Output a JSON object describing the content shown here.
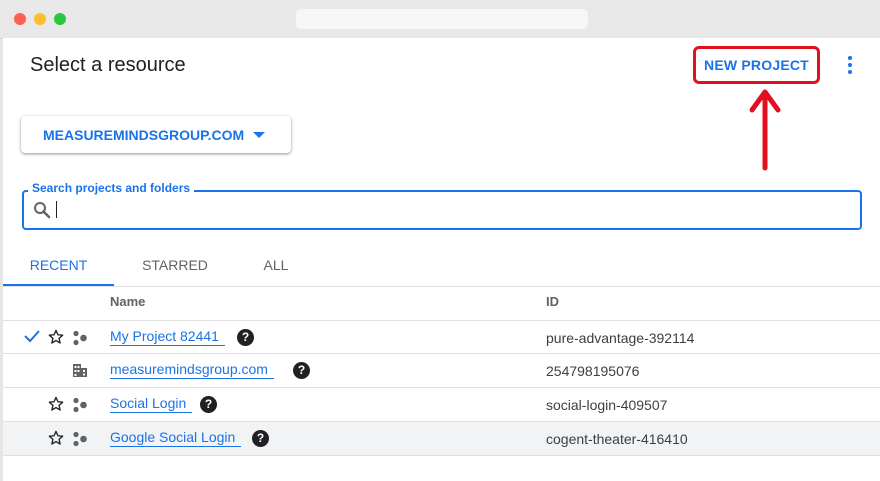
{
  "dialog": {
    "title": "Select a resource",
    "new_project_label": "NEW PROJECT",
    "org_selector_label": "MEASUREMINDSGROUP.COM",
    "search_label": "Search projects and folders",
    "tabs": [
      {
        "label": "RECENT",
        "active": true
      },
      {
        "label": "STARRED",
        "active": false
      },
      {
        "label": "ALL",
        "active": false
      }
    ],
    "columns": {
      "name": "Name",
      "id": "ID"
    },
    "rows": [
      {
        "name": "My Project 82441",
        "id": "pure-advantage-392114",
        "selected": true,
        "type": "project"
      },
      {
        "name": "measuremindsgroup.com",
        "id": "254798195076",
        "selected": false,
        "type": "organization"
      },
      {
        "name": "Social Login",
        "id": "social-login-409507",
        "selected": false,
        "type": "project"
      },
      {
        "name": "Google Social Login",
        "id": "cogent-theater-416410",
        "selected": false,
        "type": "project"
      }
    ],
    "help_glyph": "?"
  },
  "colors": {
    "accent": "#1a73e8",
    "highlight": "#e0101f"
  }
}
